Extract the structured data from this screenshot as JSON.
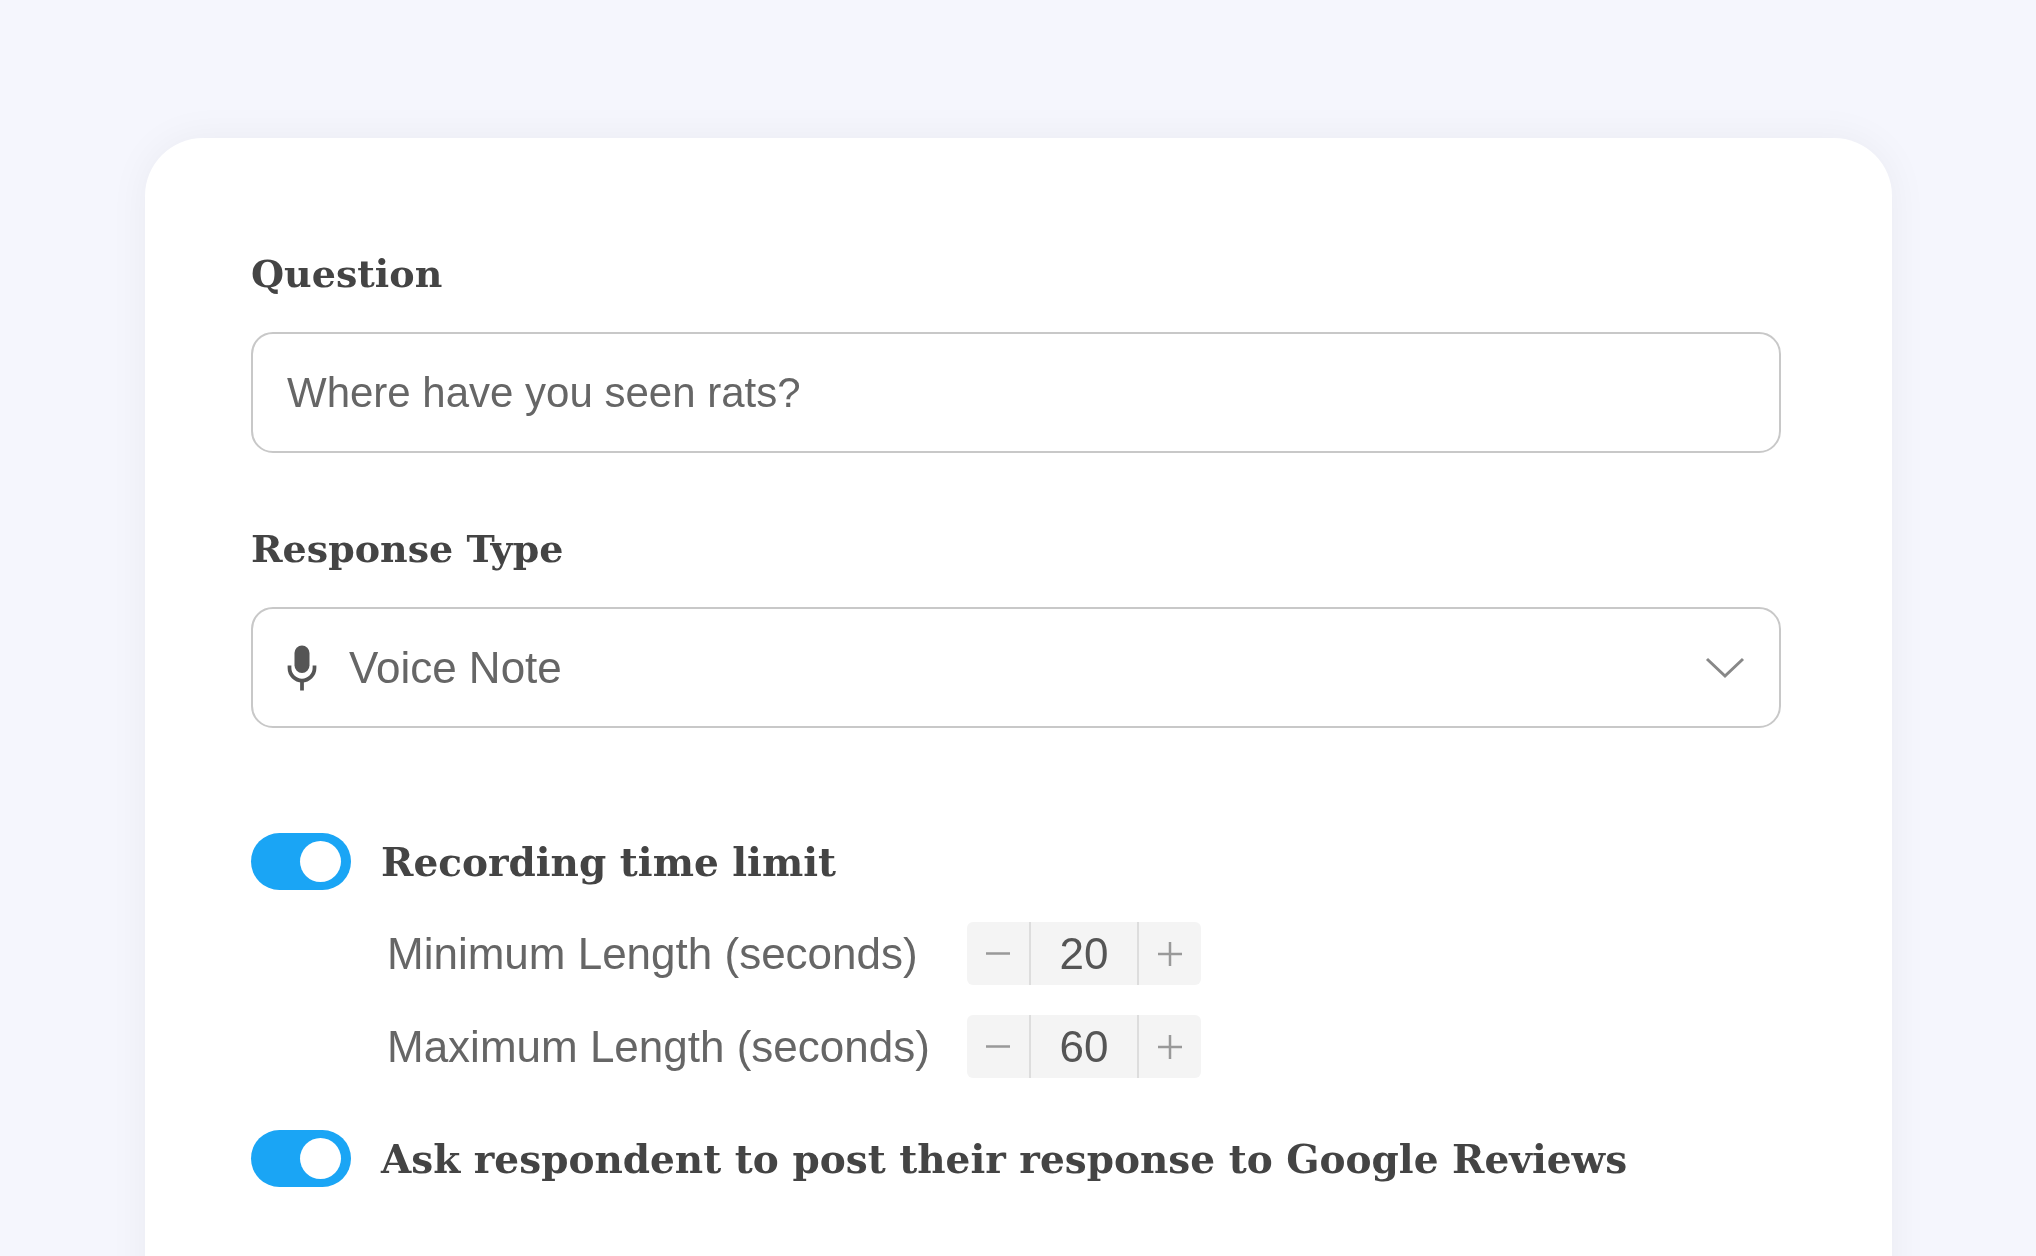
{
  "question": {
    "label": "Question",
    "value": "Where have you seen rats?"
  },
  "response_type": {
    "label": "Response Type",
    "value": "Voice Note"
  },
  "options": [
    {
      "label": "Recording time limit",
      "on": true,
      "fields": [
        {
          "label": "Minimum Length (seconds)",
          "value": "20"
        },
        {
          "label": "Maximum Length (seconds)",
          "value": "60"
        }
      ]
    },
    {
      "label": "Ask respondent to post their response to Google Reviews",
      "on": true
    }
  ]
}
